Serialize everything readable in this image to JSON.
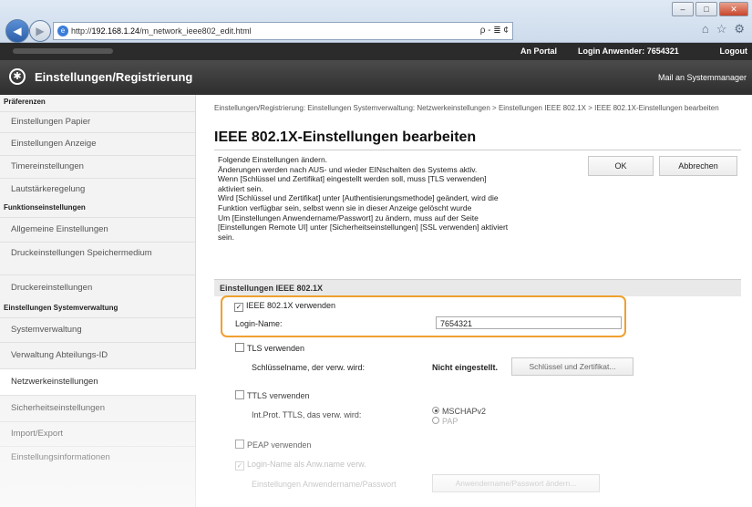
{
  "browser": {
    "url_prefix": "http://",
    "url_host": "192.168.1.24",
    "url_path": "/m_network_ieee802_edit.html",
    "url_tools": "ρ - ≣ ¢"
  },
  "topbar": {
    "portal": "An Portal",
    "login_user_label": "Login Anwender:",
    "login_user_value": "7654321",
    "logout": "Logout"
  },
  "header": {
    "title": "Einstellungen/Registrierung",
    "mail": "Mail an Systemmanager"
  },
  "sidebar": {
    "sections": [
      {
        "heading": "Präferenzen",
        "items": [
          "Einstellungen Papier",
          "Einstellungen Anzeige",
          "Timereinstellungen",
          "Lautstärkeregelung"
        ]
      },
      {
        "heading": "Funktionseinstellungen",
        "items": [
          "Allgemeine Einstellungen",
          "Druckeinstellungen Speichermedium",
          "Druckereinstellungen"
        ]
      },
      {
        "heading": "Einstellungen Systemverwaltung",
        "items": [
          "Systemverwaltung",
          "Verwaltung Abteilungs-ID",
          "Netzwerkeinstellungen",
          "Sicherheitseinstellungen",
          "Import/Export",
          "Einstellungsinformationen"
        ]
      }
    ],
    "active": "Netzwerkeinstellungen"
  },
  "main": {
    "breadcrumb": "Einstellungen/Registrierung: Einstellungen Systemverwaltung: Netzwerkeinstellungen > Einstellungen IEEE 802.1X > IEEE 802.1X-Einstellungen bearbeiten",
    "title": "IEEE 802.1X-Einstellungen bearbeiten",
    "description": [
      "Folgende Einstellungen ändern.",
      "Änderungen werden nach AUS- und wieder EINschalten des Systems aktiv.",
      "Wenn [Schlüssel und Zertifikat] eingestellt werden soll, muss [TLS verwenden]",
      "aktiviert sein.",
      "Wird [Schlüssel und Zertifikat] unter [Authentisierungsmethode] geändert, wird die",
      "Funktion verfügbar sein, selbst wenn sie in dieser Anzeige gelöscht wurde",
      "Um [Einstellungen Anwendername/Passwort] zu ändern, muss auf der Seite",
      "[Einstellungen Remote UI] unter [Sicherheitseinstellungen] [SSL verwenden] aktiviert",
      "sein."
    ],
    "ok_label": "OK",
    "cancel_label": "Abbrechen",
    "section_title": "Einstellungen IEEE 802.1X",
    "use_ieee_label": "IEEE 802.1X verwenden",
    "use_ieee_checked": true,
    "login_name_label": "Login-Name:",
    "login_name_value": "7654321",
    "tls_label": "TLS verwenden",
    "tls_checked": false,
    "key_name_label": "Schlüsselname, der verw. wird:",
    "key_name_value": "Nicht eingestellt.",
    "key_cert_button": "Schlüssel und Zertifikat...",
    "ttls_label": "TTLS verwenden",
    "ttls_checked": false,
    "ttls_protocol_label": "Int.Prot. TTLS, das verw. wird:",
    "ttls_options": [
      "MSCHAPv2",
      "PAP"
    ],
    "ttls_selected": "MSCHAPv2",
    "peap_label": "PEAP verwenden",
    "peap_checked": false,
    "login_as_user_label": "Login-Name als Anw.name verw.",
    "login_as_user_checked": true,
    "user_pwd_label": "Einstellungen Anwendername/Passwort",
    "user_pwd_button": "Anwendername/Passwort ändern..."
  }
}
